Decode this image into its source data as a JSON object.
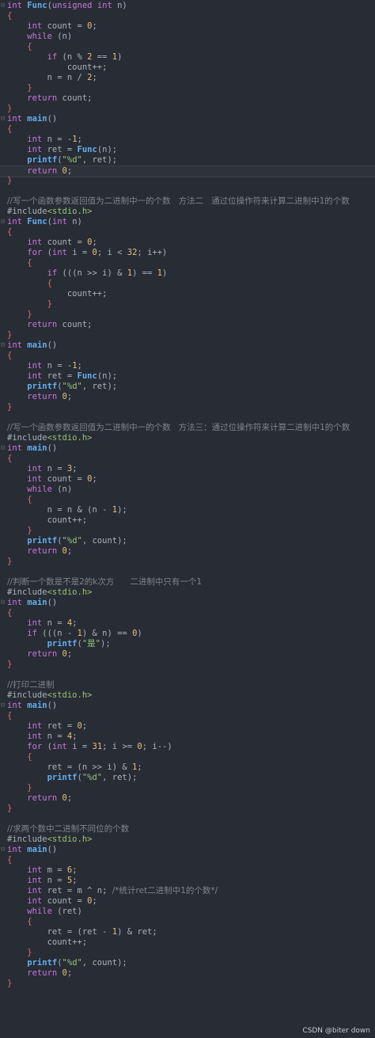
{
  "watermark": "CSDN @biter down",
  "code_lines": [
    {
      "m": "⊟",
      "t": [
        {
          "c": "kw",
          "s": "int "
        },
        {
          "c": "fn",
          "s": "Func"
        },
        {
          "c": "",
          "s": "("
        },
        {
          "c": "kw",
          "s": "unsigned int "
        },
        {
          "c": "",
          "s": "n)"
        }
      ]
    },
    {
      "m": "",
      "t": [
        {
          "c": "brace",
          "s": "{"
        }
      ]
    },
    {
      "m": "",
      "t": [
        {
          "c": "kw",
          "s": "    int "
        },
        {
          "c": "",
          "s": "count = "
        },
        {
          "c": "num",
          "s": "0"
        },
        {
          "c": "",
          "s": ";"
        }
      ]
    },
    {
      "m": "",
      "t": [
        {
          "c": "kw",
          "s": "    while "
        },
        {
          "c": "",
          "s": "(n)"
        }
      ]
    },
    {
      "m": "",
      "t": [
        {
          "c": "brace",
          "s": "    {"
        }
      ]
    },
    {
      "m": "",
      "t": [
        {
          "c": "kw",
          "s": "        if "
        },
        {
          "c": "",
          "s": "(n % "
        },
        {
          "c": "num",
          "s": "2"
        },
        {
          "c": "",
          "s": " == "
        },
        {
          "c": "num",
          "s": "1"
        },
        {
          "c": "",
          "s": ")"
        }
      ]
    },
    {
      "m": "",
      "t": [
        {
          "c": "",
          "s": "            count++;"
        }
      ]
    },
    {
      "m": "",
      "t": [
        {
          "c": "",
          "s": "        n = n / "
        },
        {
          "c": "num",
          "s": "2"
        },
        {
          "c": "",
          "s": ";"
        }
      ]
    },
    {
      "m": "",
      "t": [
        {
          "c": "brace",
          "s": "    }"
        }
      ]
    },
    {
      "m": "",
      "t": [
        {
          "c": "kw",
          "s": "    return "
        },
        {
          "c": "",
          "s": "count;"
        }
      ]
    },
    {
      "m": "",
      "t": [
        {
          "c": "brace",
          "s": "}"
        }
      ]
    },
    {
      "m": "⊟",
      "t": [
        {
          "c": "kw",
          "s": "int "
        },
        {
          "c": "fn",
          "s": "main"
        },
        {
          "c": "",
          "s": "()"
        }
      ]
    },
    {
      "m": "",
      "t": [
        {
          "c": "brace",
          "s": "{"
        }
      ]
    },
    {
      "m": "",
      "t": [
        {
          "c": "kw",
          "s": "    int "
        },
        {
          "c": "",
          "s": "n = "
        },
        {
          "c": "num",
          "s": "-1"
        },
        {
          "c": "",
          "s": ";"
        }
      ]
    },
    {
      "m": "",
      "t": [
        {
          "c": "kw",
          "s": "    int "
        },
        {
          "c": "",
          "s": "ret = "
        },
        {
          "c": "fn",
          "s": "Func"
        },
        {
          "c": "",
          "s": "(n);"
        }
      ]
    },
    {
      "m": "",
      "t": [
        {
          "c": "fn",
          "s": "    printf"
        },
        {
          "c": "",
          "s": "("
        },
        {
          "c": "str",
          "s": "\"%d\""
        },
        {
          "c": "",
          "s": ", ret);"
        }
      ]
    },
    {
      "m": "",
      "a": true,
      "t": [
        {
          "c": "kw",
          "s": "    return "
        },
        {
          "c": "num",
          "s": "0"
        },
        {
          "c": "",
          "s": ";"
        }
      ]
    },
    {
      "m": "",
      "t": [
        {
          "c": "brace",
          "s": "}"
        }
      ]
    },
    {
      "m": "",
      "t": []
    },
    {
      "m": "",
      "t": [
        {
          "c": "cm",
          "s": "//写一个函数参数返回值为二进制中一的个数   方法二   通过位操作符来计算二进制中1的个数"
        }
      ]
    },
    {
      "m": "",
      "t": [
        {
          "c": "inc",
          "s": "#include"
        },
        {
          "c": "hdr",
          "s": "<stdio.h>"
        }
      ]
    },
    {
      "m": "⊟",
      "t": [
        {
          "c": "kw",
          "s": "int "
        },
        {
          "c": "fn",
          "s": "Func"
        },
        {
          "c": "",
          "s": "("
        },
        {
          "c": "kw",
          "s": "int "
        },
        {
          "c": "",
          "s": "n)"
        }
      ]
    },
    {
      "m": "",
      "t": [
        {
          "c": "brace",
          "s": "{"
        }
      ]
    },
    {
      "m": "",
      "t": [
        {
          "c": "kw",
          "s": "    int "
        },
        {
          "c": "",
          "s": "count = "
        },
        {
          "c": "num",
          "s": "0"
        },
        {
          "c": "",
          "s": ";"
        }
      ]
    },
    {
      "m": "",
      "t": [
        {
          "c": "kw",
          "s": "    for "
        },
        {
          "c": "",
          "s": "("
        },
        {
          "c": "kw",
          "s": "int "
        },
        {
          "c": "",
          "s": "i = "
        },
        {
          "c": "num",
          "s": "0"
        },
        {
          "c": "",
          "s": "; i < "
        },
        {
          "c": "num",
          "s": "32"
        },
        {
          "c": "",
          "s": "; i++)"
        }
      ]
    },
    {
      "m": "",
      "t": [
        {
          "c": "brace",
          "s": "    {"
        }
      ]
    },
    {
      "m": "",
      "t": [
        {
          "c": "kw",
          "s": "        if "
        },
        {
          "c": "",
          "s": "(((n >> i) & "
        },
        {
          "c": "num",
          "s": "1"
        },
        {
          "c": "",
          "s": ") == "
        },
        {
          "c": "num",
          "s": "1"
        },
        {
          "c": "",
          "s": ")"
        }
      ]
    },
    {
      "m": "",
      "t": [
        {
          "c": "brace",
          "s": "        {"
        }
      ]
    },
    {
      "m": "",
      "t": [
        {
          "c": "",
          "s": "            count++;"
        }
      ]
    },
    {
      "m": "",
      "t": [
        {
          "c": "brace",
          "s": "        }"
        }
      ]
    },
    {
      "m": "",
      "t": [
        {
          "c": "brace",
          "s": "    }"
        }
      ]
    },
    {
      "m": "",
      "t": [
        {
          "c": "kw",
          "s": "    return "
        },
        {
          "c": "",
          "s": "count;"
        }
      ]
    },
    {
      "m": "",
      "t": [
        {
          "c": "brace",
          "s": "}"
        }
      ]
    },
    {
      "m": "⊟",
      "t": [
        {
          "c": "kw",
          "s": "int "
        },
        {
          "c": "fn",
          "s": "main"
        },
        {
          "c": "",
          "s": "()"
        }
      ]
    },
    {
      "m": "",
      "t": [
        {
          "c": "brace",
          "s": "{"
        }
      ]
    },
    {
      "m": "",
      "t": [
        {
          "c": "kw",
          "s": "    int "
        },
        {
          "c": "",
          "s": "n = "
        },
        {
          "c": "num",
          "s": "-1"
        },
        {
          "c": "",
          "s": ";"
        }
      ]
    },
    {
      "m": "",
      "t": [
        {
          "c": "kw",
          "s": "    int "
        },
        {
          "c": "",
          "s": "ret = "
        },
        {
          "c": "fn",
          "s": "Func"
        },
        {
          "c": "",
          "s": "(n);"
        }
      ]
    },
    {
      "m": "",
      "t": [
        {
          "c": "fn",
          "s": "    printf"
        },
        {
          "c": "",
          "s": "("
        },
        {
          "c": "str",
          "s": "\"%d\""
        },
        {
          "c": "",
          "s": ", ret);"
        }
      ]
    },
    {
      "m": "",
      "t": [
        {
          "c": "kw",
          "s": "    return "
        },
        {
          "c": "num",
          "s": "0"
        },
        {
          "c": "",
          "s": ";"
        }
      ]
    },
    {
      "m": "",
      "t": [
        {
          "c": "brace",
          "s": "}"
        }
      ]
    },
    {
      "m": "",
      "t": []
    },
    {
      "m": "",
      "t": [
        {
          "c": "cm",
          "s": "//写一个函数参数返回值为二进制中一的个数   方法三：通过位操作符来计算二进制中1的个数"
        }
      ]
    },
    {
      "m": "",
      "t": [
        {
          "c": "inc",
          "s": "#include"
        },
        {
          "c": "hdr",
          "s": "<stdio.h>"
        }
      ]
    },
    {
      "m": "⊟",
      "t": [
        {
          "c": "kw",
          "s": "int "
        },
        {
          "c": "fn",
          "s": "main"
        },
        {
          "c": "",
          "s": "()"
        }
      ]
    },
    {
      "m": "",
      "t": [
        {
          "c": "brace",
          "s": "{"
        }
      ]
    },
    {
      "m": "",
      "t": [
        {
          "c": "kw",
          "s": "    int "
        },
        {
          "c": "",
          "s": "n = "
        },
        {
          "c": "num",
          "s": "3"
        },
        {
          "c": "",
          "s": ";"
        }
      ]
    },
    {
      "m": "",
      "t": [
        {
          "c": "kw",
          "s": "    int "
        },
        {
          "c": "",
          "s": "count = "
        },
        {
          "c": "num",
          "s": "0"
        },
        {
          "c": "",
          "s": ";"
        }
      ]
    },
    {
      "m": "",
      "t": [
        {
          "c": "kw",
          "s": "    while "
        },
        {
          "c": "",
          "s": "(n)"
        }
      ]
    },
    {
      "m": "",
      "t": [
        {
          "c": "brace",
          "s": "    {"
        }
      ]
    },
    {
      "m": "",
      "t": [
        {
          "c": "",
          "s": "        n = n & (n - "
        },
        {
          "c": "num",
          "s": "1"
        },
        {
          "c": "",
          "s": ");"
        }
      ]
    },
    {
      "m": "",
      "t": [
        {
          "c": "",
          "s": "        count++;"
        }
      ]
    },
    {
      "m": "",
      "t": [
        {
          "c": "brace",
          "s": "    }"
        }
      ]
    },
    {
      "m": "",
      "t": [
        {
          "c": "fn",
          "s": "    printf"
        },
        {
          "c": "",
          "s": "("
        },
        {
          "c": "str",
          "s": "\"%d\""
        },
        {
          "c": "",
          "s": ", count);"
        }
      ]
    },
    {
      "m": "",
      "t": [
        {
          "c": "kw",
          "s": "    return "
        },
        {
          "c": "num",
          "s": "0"
        },
        {
          "c": "",
          "s": ";"
        }
      ]
    },
    {
      "m": "",
      "t": [
        {
          "c": "brace",
          "s": "}"
        }
      ]
    },
    {
      "m": "",
      "t": []
    },
    {
      "m": "",
      "t": [
        {
          "c": "cm",
          "s": "//判断一个数是不是2的k次方      二进制中只有一个1"
        }
      ]
    },
    {
      "m": "",
      "t": [
        {
          "c": "inc",
          "s": "#include"
        },
        {
          "c": "hdr",
          "s": "<stdio.h>"
        }
      ]
    },
    {
      "m": "⊟",
      "t": [
        {
          "c": "kw",
          "s": "int "
        },
        {
          "c": "fn",
          "s": "main"
        },
        {
          "c": "",
          "s": "()"
        }
      ]
    },
    {
      "m": "",
      "t": [
        {
          "c": "brace",
          "s": "{"
        }
      ]
    },
    {
      "m": "",
      "t": [
        {
          "c": "kw",
          "s": "    int "
        },
        {
          "c": "",
          "s": "n = "
        },
        {
          "c": "num",
          "s": "4"
        },
        {
          "c": "",
          "s": ";"
        }
      ]
    },
    {
      "m": "",
      "t": [
        {
          "c": "kw",
          "s": "    if "
        },
        {
          "c": "",
          "s": "(((n - "
        },
        {
          "c": "num",
          "s": "1"
        },
        {
          "c": "",
          "s": ") & n) == "
        },
        {
          "c": "num",
          "s": "0"
        },
        {
          "c": "",
          "s": ")"
        }
      ]
    },
    {
      "m": "",
      "t": [
        {
          "c": "fn",
          "s": "        printf"
        },
        {
          "c": "",
          "s": "("
        },
        {
          "c": "str",
          "s": "\"是\""
        },
        {
          "c": "",
          "s": ");"
        }
      ]
    },
    {
      "m": "",
      "t": [
        {
          "c": "kw",
          "s": "    return "
        },
        {
          "c": "num",
          "s": "0"
        },
        {
          "c": "",
          "s": ";"
        }
      ]
    },
    {
      "m": "",
      "t": [
        {
          "c": "brace",
          "s": "}"
        }
      ]
    },
    {
      "m": "",
      "t": []
    },
    {
      "m": "",
      "t": [
        {
          "c": "cm",
          "s": "//打印二进制"
        }
      ]
    },
    {
      "m": "",
      "t": [
        {
          "c": "inc",
          "s": "#include"
        },
        {
          "c": "hdr",
          "s": "<stdio.h>"
        }
      ]
    },
    {
      "m": "⊟",
      "t": [
        {
          "c": "kw",
          "s": "int "
        },
        {
          "c": "fn",
          "s": "main"
        },
        {
          "c": "",
          "s": "()"
        }
      ]
    },
    {
      "m": "",
      "t": [
        {
          "c": "brace",
          "s": "{"
        }
      ]
    },
    {
      "m": "",
      "t": [
        {
          "c": "kw",
          "s": "    int "
        },
        {
          "c": "",
          "s": "ret = "
        },
        {
          "c": "num",
          "s": "0"
        },
        {
          "c": "",
          "s": ";"
        }
      ]
    },
    {
      "m": "",
      "t": [
        {
          "c": "kw",
          "s": "    int "
        },
        {
          "c": "",
          "s": "n = "
        },
        {
          "c": "num",
          "s": "4"
        },
        {
          "c": "",
          "s": ";"
        }
      ]
    },
    {
      "m": "",
      "t": [
        {
          "c": "kw",
          "s": "    for "
        },
        {
          "c": "",
          "s": "("
        },
        {
          "c": "kw",
          "s": "int "
        },
        {
          "c": "",
          "s": "i = "
        },
        {
          "c": "num",
          "s": "31"
        },
        {
          "c": "",
          "s": "; i >= "
        },
        {
          "c": "num",
          "s": "0"
        },
        {
          "c": "",
          "s": "; i--)"
        }
      ]
    },
    {
      "m": "",
      "t": [
        {
          "c": "brace",
          "s": "    {"
        }
      ]
    },
    {
      "m": "",
      "t": [
        {
          "c": "",
          "s": "        ret = (n >> i) & "
        },
        {
          "c": "num",
          "s": "1"
        },
        {
          "c": "",
          "s": ";"
        }
      ]
    },
    {
      "m": "",
      "t": [
        {
          "c": "fn",
          "s": "        printf"
        },
        {
          "c": "",
          "s": "("
        },
        {
          "c": "str",
          "s": "\"%d\""
        },
        {
          "c": "",
          "s": ", ret);"
        }
      ]
    },
    {
      "m": "",
      "t": [
        {
          "c": "brace",
          "s": "    }"
        }
      ]
    },
    {
      "m": "",
      "t": [
        {
          "c": "kw",
          "s": "    return "
        },
        {
          "c": "num",
          "s": "0"
        },
        {
          "c": "",
          "s": ";"
        }
      ]
    },
    {
      "m": "",
      "t": [
        {
          "c": "brace",
          "s": "}"
        }
      ]
    },
    {
      "m": "",
      "t": []
    },
    {
      "m": "",
      "t": [
        {
          "c": "cm",
          "s": "//求两个数中二进制不同位的个数"
        }
      ]
    },
    {
      "m": "",
      "t": [
        {
          "c": "inc",
          "s": "#include"
        },
        {
          "c": "hdr",
          "s": "<stdio.h>"
        }
      ]
    },
    {
      "m": "⊟",
      "t": [
        {
          "c": "kw",
          "s": "int "
        },
        {
          "c": "fn",
          "s": "main"
        },
        {
          "c": "",
          "s": "()"
        }
      ]
    },
    {
      "m": "",
      "t": [
        {
          "c": "brace",
          "s": "{"
        }
      ]
    },
    {
      "m": "",
      "t": [
        {
          "c": "kw",
          "s": "    int "
        },
        {
          "c": "",
          "s": "m = "
        },
        {
          "c": "num",
          "s": "6"
        },
        {
          "c": "",
          "s": ";"
        }
      ]
    },
    {
      "m": "",
      "t": [
        {
          "c": "kw",
          "s": "    int "
        },
        {
          "c": "",
          "s": "n = "
        },
        {
          "c": "num",
          "s": "5"
        },
        {
          "c": "",
          "s": ";"
        }
      ]
    },
    {
      "m": "",
      "t": [
        {
          "c": "kw",
          "s": "    int "
        },
        {
          "c": "",
          "s": "ret = m ^ n; "
        },
        {
          "c": "cm",
          "s": "/*统计ret二进制中1的个数*/"
        }
      ]
    },
    {
      "m": "",
      "t": [
        {
          "c": "kw",
          "s": "    int "
        },
        {
          "c": "",
          "s": "count = "
        },
        {
          "c": "num",
          "s": "0"
        },
        {
          "c": "",
          "s": ";"
        }
      ]
    },
    {
      "m": "",
      "t": [
        {
          "c": "kw",
          "s": "    while "
        },
        {
          "c": "",
          "s": "(ret)"
        }
      ]
    },
    {
      "m": "",
      "t": [
        {
          "c": "brace",
          "s": "    {"
        }
      ]
    },
    {
      "m": "",
      "t": [
        {
          "c": "",
          "s": "        ret = (ret - "
        },
        {
          "c": "num",
          "s": "1"
        },
        {
          "c": "",
          "s": ") & ret;"
        }
      ]
    },
    {
      "m": "",
      "t": [
        {
          "c": "",
          "s": "        count++;"
        }
      ]
    },
    {
      "m": "",
      "t": [
        {
          "c": "brace",
          "s": "    }"
        }
      ]
    },
    {
      "m": "",
      "t": [
        {
          "c": "fn",
          "s": "    printf"
        },
        {
          "c": "",
          "s": "("
        },
        {
          "c": "str",
          "s": "\"%d\""
        },
        {
          "c": "",
          "s": ", count);"
        }
      ]
    },
    {
      "m": "",
      "t": [
        {
          "c": "kw",
          "s": "    return "
        },
        {
          "c": "num",
          "s": "0"
        },
        {
          "c": "",
          "s": ";"
        }
      ]
    },
    {
      "m": "",
      "t": [
        {
          "c": "brace",
          "s": "}"
        }
      ]
    }
  ]
}
